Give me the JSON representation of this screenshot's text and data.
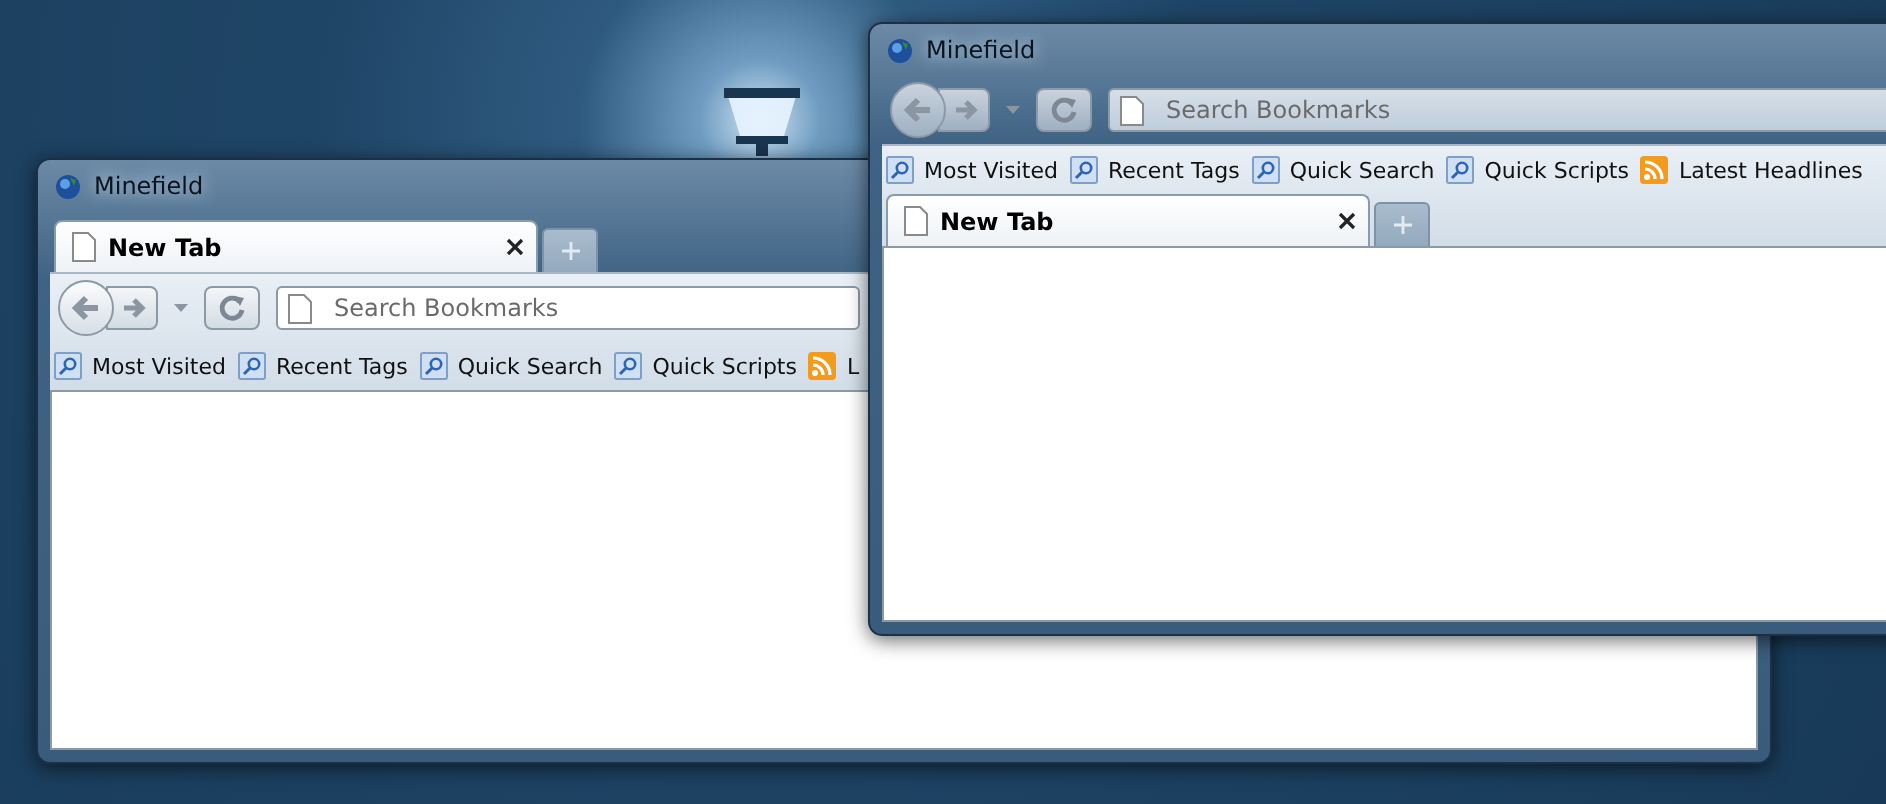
{
  "windows": [
    {
      "title": "Minefield",
      "kind": "tabs_on_top",
      "tabs": [
        {
          "label": "New Tab",
          "selected": true
        }
      ],
      "search": {
        "placeholder": "Search Bookmarks"
      },
      "bookmarks": [
        {
          "label": "Most Visited",
          "kind": "query"
        },
        {
          "label": "Recent Tags",
          "kind": "query"
        },
        {
          "label": "Quick Search",
          "kind": "query"
        },
        {
          "label": "Quick Scripts",
          "kind": "query"
        },
        {
          "label": "L",
          "kind": "feed"
        }
      ]
    },
    {
      "title": "Minefield",
      "kind": "tabs_below",
      "tabs": [
        {
          "label": "New Tab",
          "selected": true
        }
      ],
      "search": {
        "placeholder": "Search Bookmarks"
      },
      "bookmarks": [
        {
          "label": "Most Visited",
          "kind": "query"
        },
        {
          "label": "Recent Tags",
          "kind": "query"
        },
        {
          "label": "Quick Search",
          "kind": "query"
        },
        {
          "label": "Quick Scripts",
          "kind": "query"
        },
        {
          "label": "Latest Headlines",
          "kind": "feed"
        }
      ]
    }
  ]
}
